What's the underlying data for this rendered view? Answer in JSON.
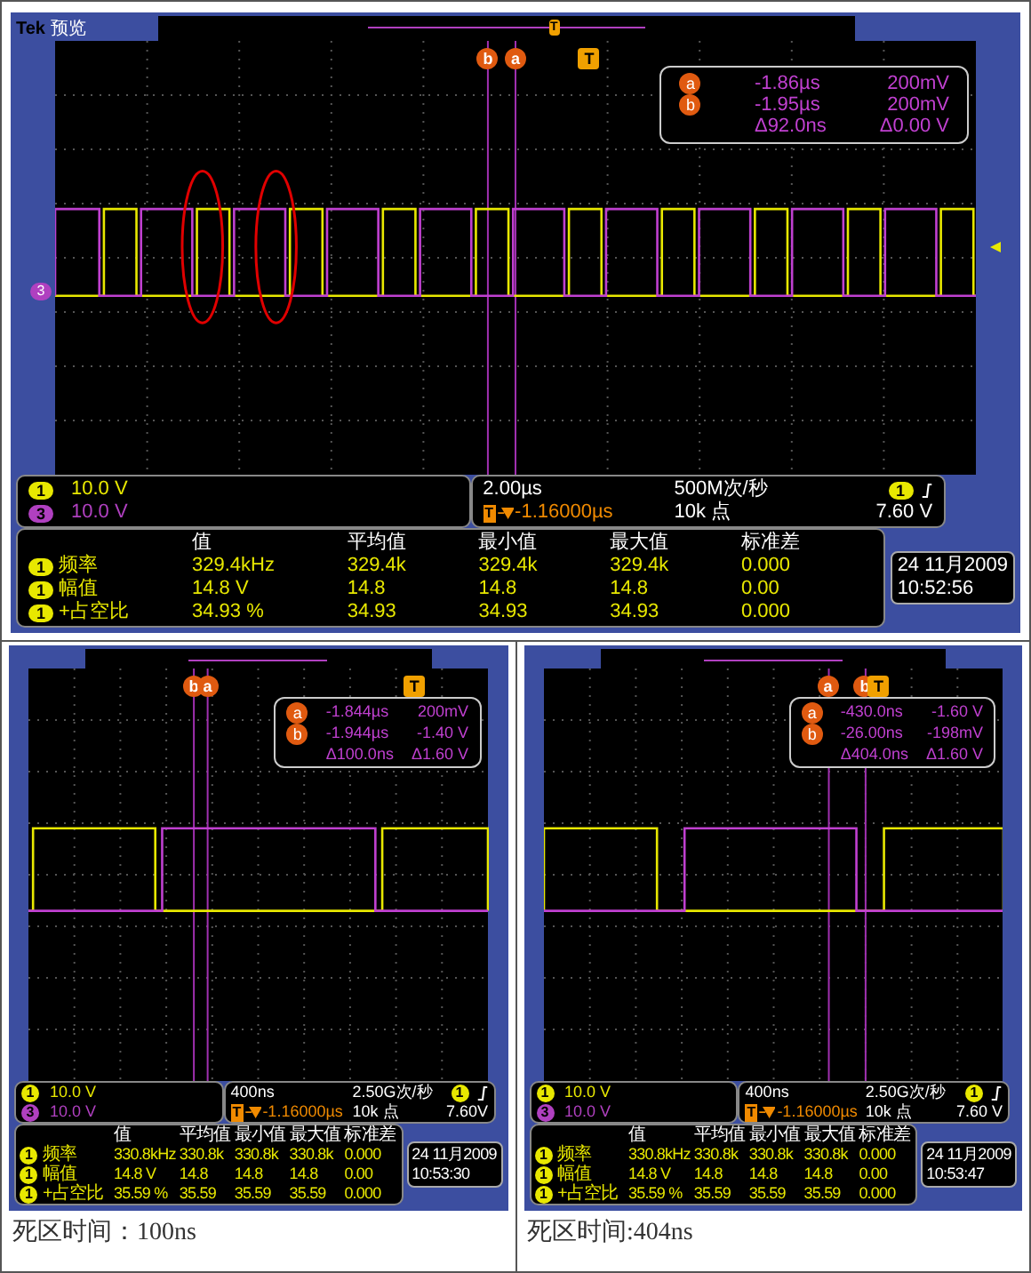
{
  "screens": [
    {
      "brand": "Tek",
      "mode": "预览",
      "overview_marker": "T",
      "ground_marker": {
        "badge": "3",
        "color": "#b040c0"
      },
      "markers": [
        {
          "label": "b",
          "kind": "cursor"
        },
        {
          "label": "a",
          "kind": "cursor"
        },
        {
          "label": "T",
          "kind": "trigger"
        }
      ],
      "readout": {
        "rows": [
          {
            "label": "a",
            "time": "-1.86µs",
            "volt": "200mV"
          },
          {
            "label": "b",
            "time": "-1.95µs",
            "volt": "200mV"
          }
        ],
        "delta_time": "Δ92.0ns",
        "delta_volt": "Δ0.00 V"
      },
      "channels": [
        {
          "badge": "1",
          "scale": "10.0 V",
          "color": "#e8e800"
        },
        {
          "badge": "3",
          "scale": "10.0 V",
          "color": "#b040c0"
        }
      ],
      "timebase": {
        "scale": "2.00µs",
        "rate": "500M次/秒",
        "trigger_channel": "1",
        "trigger_badge": "T",
        "position": "-1.16000µs",
        "record": "10k 点",
        "trigger_level": "7.60 V"
      },
      "measurements": {
        "columns": [
          "值",
          "平均值",
          "最小值",
          "最大值",
          "标准差"
        ],
        "rows": [
          {
            "badge": "1",
            "name": "频率",
            "values": [
              "329.4kHz",
              "329.4k",
              "329.4k",
              "329.4k",
              "0.000"
            ]
          },
          {
            "badge": "1",
            "name": "幅值",
            "values": [
              "14.8 V",
              "14.8",
              "14.8",
              "14.8",
              "0.00"
            ]
          },
          {
            "badge": "1",
            "name": "+占空比",
            "values": [
              "34.93 %",
              "34.93",
              "34.93",
              "34.93",
              "0.000"
            ]
          }
        ]
      },
      "date": "24 11月2009",
      "time": "10:52:56"
    },
    {
      "markers": [
        {
          "label": "b",
          "kind": "cursor"
        },
        {
          "label": "a",
          "kind": "cursor"
        },
        {
          "label": "T",
          "kind": "trigger"
        }
      ],
      "readout": {
        "rows": [
          {
            "label": "a",
            "time": "-1.844µs",
            "volt": "200mV"
          },
          {
            "label": "b",
            "time": "-1.944µs",
            "volt": "-1.40 V"
          }
        ],
        "delta_time": "Δ100.0ns",
        "delta_volt": "Δ1.60 V"
      },
      "channels": [
        {
          "badge": "1",
          "scale": "10.0 V",
          "color": "#e8e800"
        },
        {
          "badge": "3",
          "scale": "10.0 V",
          "color": "#b040c0"
        }
      ],
      "timebase": {
        "scale": "400ns",
        "rate": "2.50G次/秒",
        "trigger_channel": "1",
        "trigger_badge": "T",
        "position": "-1.16000µs",
        "record": "10k 点",
        "trigger_level": "7.60V"
      },
      "measurements": {
        "columns": [
          "值",
          "平均值",
          "最小值",
          "最大值",
          "标准差"
        ],
        "rows": [
          {
            "badge": "1",
            "name": "频率",
            "values": [
              "330.8kHz",
              "330.8k",
              "330.8k",
              "330.8k",
              "0.000"
            ]
          },
          {
            "badge": "1",
            "name": "幅值",
            "values": [
              "14.8 V",
              "14.8",
              "14.8",
              "14.8",
              "0.00"
            ]
          },
          {
            "badge": "1",
            "name": "+占空比",
            "values": [
              "35.59 %",
              "35.59",
              "35.59",
              "35.59",
              "0.000"
            ]
          }
        ]
      },
      "date": "24 11月2009",
      "time": "10:53:30",
      "caption": "死区时间：100ns"
    },
    {
      "markers": [
        {
          "label": "a",
          "kind": "cursor"
        },
        {
          "label": "b",
          "kind": "cursor"
        },
        {
          "label": "T",
          "kind": "trigger"
        }
      ],
      "readout": {
        "rows": [
          {
            "label": "a",
            "time": "-430.0ns",
            "volt": "-1.60 V"
          },
          {
            "label": "b",
            "time": "-26.00ns",
            "volt": "-198mV"
          }
        ],
        "delta_time": "Δ404.0ns",
        "delta_volt": "Δ1.60 V"
      },
      "channels": [
        {
          "badge": "1",
          "scale": "10.0 V",
          "color": "#e8e800"
        },
        {
          "badge": "3",
          "scale": "10.0 V",
          "color": "#b040c0"
        }
      ],
      "timebase": {
        "scale": "400ns",
        "rate": "2.50G次/秒",
        "trigger_channel": "1",
        "trigger_badge": "T",
        "position": "-1.16000µs",
        "record": "10k 点",
        "trigger_level": "7.60 V"
      },
      "measurements": {
        "columns": [
          "值",
          "平均值",
          "最小值",
          "最大值",
          "标准差"
        ],
        "rows": [
          {
            "badge": "1",
            "name": "频率",
            "values": [
              "330.8kHz",
              "330.8k",
              "330.8k",
              "330.8k",
              "0.000"
            ]
          },
          {
            "badge": "1",
            "name": "幅值",
            "values": [
              "14.8 V",
              "14.8",
              "14.8",
              "14.8",
              "0.00"
            ]
          },
          {
            "badge": "1",
            "name": "+占空比",
            "values": [
              "35.59 %",
              "35.59",
              "35.59",
              "35.59",
              "0.000"
            ]
          }
        ]
      },
      "date": "24 11月2009",
      "time": "10:53:47",
      "caption": "死区时间:404ns"
    }
  ]
}
